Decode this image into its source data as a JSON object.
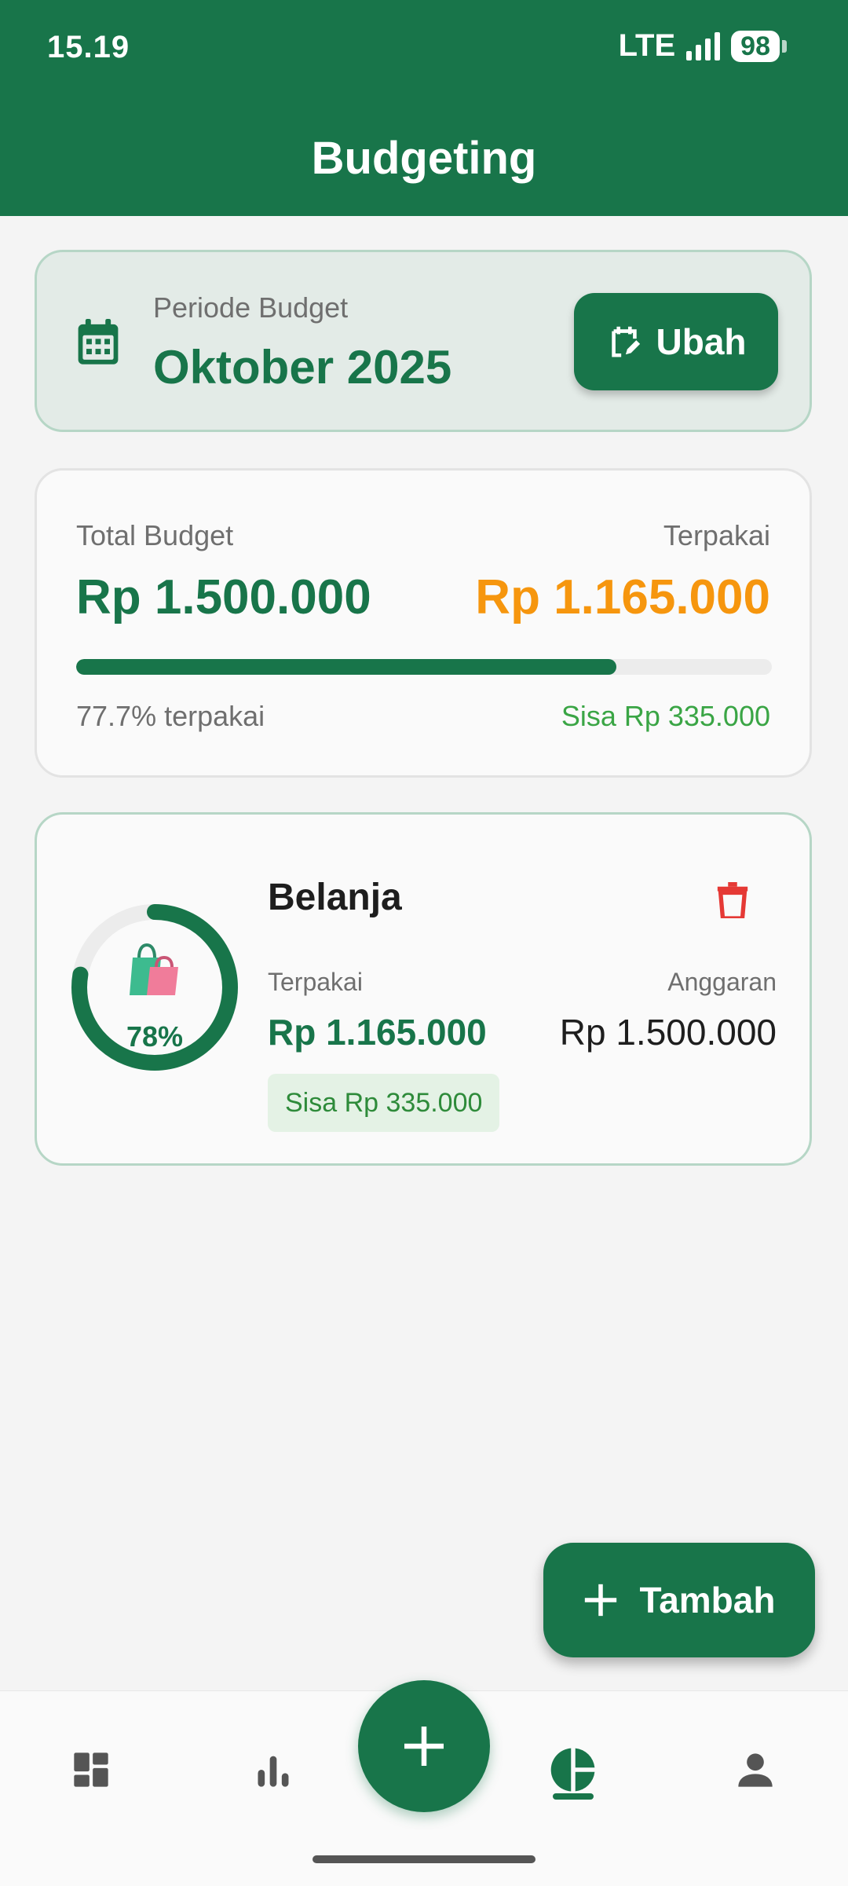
{
  "status_bar": {
    "time": "15.19",
    "network": "LTE",
    "battery": "98"
  },
  "header": {
    "title": "Budgeting"
  },
  "period": {
    "label": "Periode Budget",
    "value": "Oktober 2025",
    "change_button": "Ubah"
  },
  "summary": {
    "total_label": "Total Budget",
    "total_value": "Rp 1.500.000",
    "used_label": "Terpakai",
    "used_value": "Rp 1.165.000",
    "used_fraction": 0.777,
    "percent_text": "77.7% terpakai",
    "remaining_text": "Sisa Rp 335.000"
  },
  "categories": [
    {
      "name": "Belanja",
      "icon": "shopping-bags-icon",
      "percent_text": "78%",
      "fraction": 0.777,
      "used_label": "Terpakai",
      "used_value": "Rp 1.165.000",
      "budget_label": "Anggaran",
      "budget_value": "Rp 1.500.000",
      "remaining_text": "Sisa Rp 335.000"
    }
  ],
  "fab": {
    "label": "Tambah"
  },
  "bottom_nav": {
    "items": [
      "dashboard-icon",
      "bar-chart-icon",
      "add-icon",
      "pie-chart-icon",
      "person-icon"
    ],
    "active": "pie-chart-icon"
  },
  "colors": {
    "primary": "#18754a",
    "accent_orange": "#f6960e",
    "remaining_green": "#3aa545",
    "delete_red": "#e53935",
    "background": "#f4f4f4"
  }
}
